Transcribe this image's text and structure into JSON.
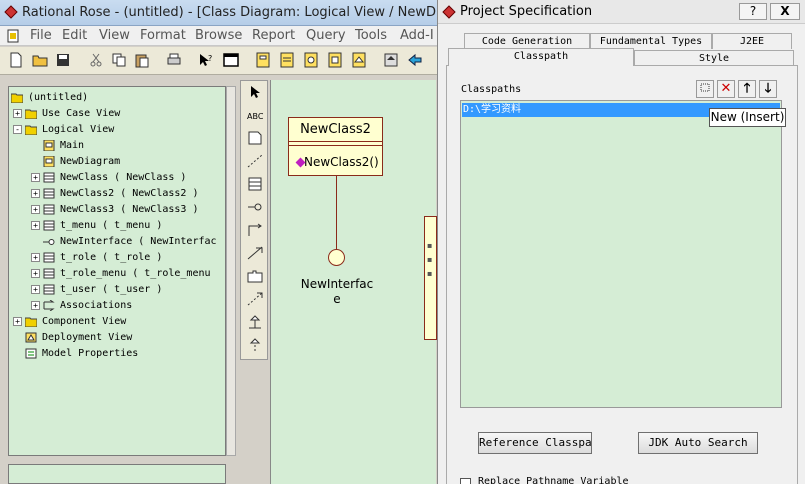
{
  "window": {
    "title": "Rational Rose - (untitled) - [Class Diagram: Logical View / NewDiagram"
  },
  "menu": [
    "File",
    "Edit",
    "View",
    "Format",
    "Browse",
    "Report",
    "Query",
    "Tools",
    "Add-I"
  ],
  "tree": {
    "root": "(untitled)",
    "items": [
      {
        "label": "Use Case View",
        "level": 1,
        "expand": "+",
        "icon": "folder"
      },
      {
        "label": "Logical View",
        "level": 1,
        "expand": "-",
        "icon": "folder"
      },
      {
        "label": "Main",
        "level": 2,
        "expand": "",
        "icon": "diagram"
      },
      {
        "label": "NewDiagram",
        "level": 2,
        "expand": "",
        "icon": "diagram"
      },
      {
        "label": "NewClass ( NewClass )",
        "level": 2,
        "expand": "+",
        "icon": "class"
      },
      {
        "label": "NewClass2 ( NewClass2 )",
        "level": 2,
        "expand": "+",
        "icon": "class"
      },
      {
        "label": "NewClass3 ( NewClass3 )",
        "level": 2,
        "expand": "+",
        "icon": "class"
      },
      {
        "label": "t_menu ( t_menu )",
        "level": 2,
        "expand": "+",
        "icon": "class"
      },
      {
        "label": "NewInterface ( NewInterfac",
        "level": 2,
        "expand": "",
        "icon": "interface"
      },
      {
        "label": "t_role ( t_role )",
        "level": 2,
        "expand": "+",
        "icon": "class"
      },
      {
        "label": "t_role_menu ( t_role_menu",
        "level": 2,
        "expand": "+",
        "icon": "class"
      },
      {
        "label": "t_user ( t_user )",
        "level": 2,
        "expand": "+",
        "icon": "class"
      },
      {
        "label": "Associations",
        "level": 2,
        "expand": "+",
        "icon": "assoc"
      },
      {
        "label": "Component View",
        "level": 1,
        "expand": "+",
        "icon": "folder"
      },
      {
        "label": "Deployment View",
        "level": 1,
        "expand": "",
        "icon": "deploy"
      },
      {
        "label": "Model Properties",
        "level": 1,
        "expand": "",
        "icon": "props"
      }
    ]
  },
  "palette": [
    "arrow",
    "ABC",
    "note",
    "anchor",
    "class",
    "interface",
    "assoc",
    "unidir",
    "package",
    "depend",
    "general",
    "realize"
  ],
  "diagram": {
    "class_name": "NewClass2",
    "operation": "NewClass2()",
    "interface_label_line1": "NewInterfac",
    "interface_label_line2": "e"
  },
  "dialog": {
    "title": "Project Specification",
    "help_button": "?",
    "close_button": "X",
    "tabs_row1": [
      "Code Generation",
      "Fundamental Types",
      "J2EE"
    ],
    "tabs_row2": [
      "Classpath",
      "Style"
    ],
    "classpaths_label": "Classpaths",
    "classpath_entry": "D:\\学习资料",
    "tooltip": "New (Insert)",
    "reference_button": "Reference Classpath",
    "jdk_button": "JDK Auto Search",
    "checkbox_label": "Replace Pathname Variable"
  },
  "colors": {
    "tree_bg": "#d5edd5",
    "class_border": "#8b2a1a",
    "class_fill": "#ffffd0",
    "selection": "#3399ff"
  }
}
